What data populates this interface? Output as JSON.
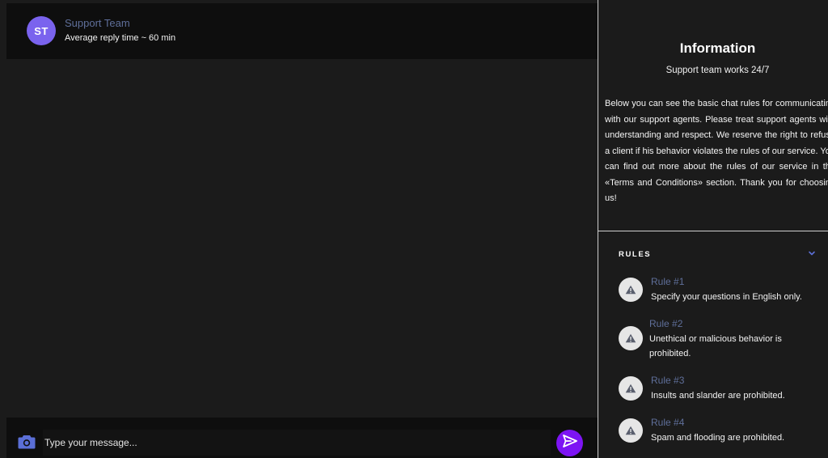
{
  "chat": {
    "avatar_initials": "ST",
    "contact_name": "Support Team",
    "contact_status": "Average reply time ~ 60 min",
    "composer": {
      "placeholder": "Type your message..."
    }
  },
  "info": {
    "title": "Information",
    "subtitle": "Support team works 24/7",
    "description": "Below you can see the basic chat rules for communicating with our support agents. Please treat support agents with understanding and respect. We reserve the right to refuse a client if his behavior violates the rules of our service. You can find out more about the rules of our service in the «Terms and Conditions» section. Thank you for choosing us!"
  },
  "rules": {
    "header": "RULES",
    "items": [
      {
        "title": "Rule #1",
        "text": "Specify your questions in English only."
      },
      {
        "title": "Rule #2",
        "text": "Unethical or malicious behavior is prohibited."
      },
      {
        "title": "Rule #3",
        "text": "Insults and slander are prohibited."
      },
      {
        "title": "Rule #4",
        "text": "Spam and flooding are prohibited."
      }
    ]
  },
  "colors": {
    "accent": "#7d14f3",
    "avatar": "#7a63ee",
    "muted_link": "#5f6f9a",
    "camera": "#5b6fd6"
  },
  "icons": {
    "camera": "camera-icon",
    "send": "send-icon",
    "rule": "warning-triangle-icon",
    "chevron": "chevron-down-icon"
  }
}
